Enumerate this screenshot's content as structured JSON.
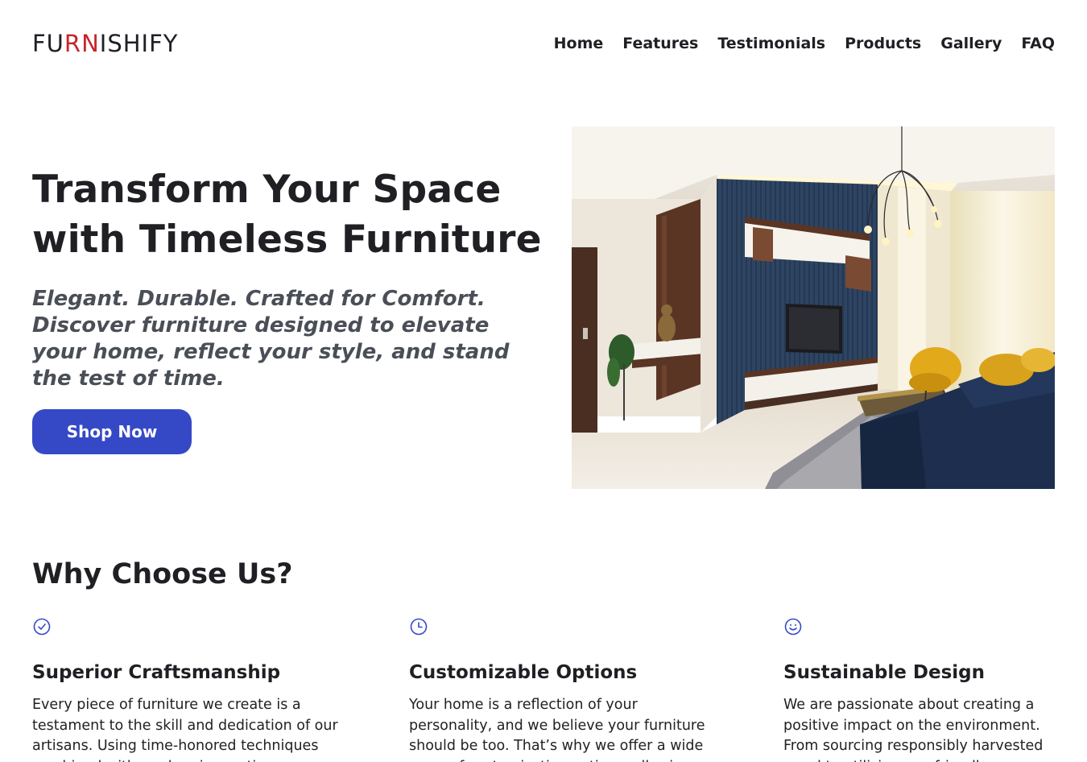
{
  "header": {
    "logo": {
      "part1": "FU",
      "accent": "RN",
      "part2": "ISHIFY"
    },
    "nav": [
      "Home",
      "Features",
      "Testimonials",
      "Products",
      "Gallery",
      "FAQ"
    ]
  },
  "hero": {
    "title_line1": "Transform Your Space",
    "title_line2": "with Timeless Furniture",
    "subtitle": "Elegant. Durable. Crafted for Comfort. Discover furniture designed to elevate your home, reflect your style, and stand the test of time.",
    "cta_label": "Shop Now"
  },
  "why": {
    "title": "Why Choose Us?",
    "features": [
      {
        "icon": "check-circle-icon",
        "title": "Superior Craftsmanship",
        "text": "Every piece of furniture we create is a testament to the skill and dedication of our artisans. Using time-honored techniques combined with modern innovations, we"
      },
      {
        "icon": "clock-icon",
        "title": "Customizable Options",
        "text": "Your home is a reflection of your personality, and we believe your furniture should be too. That’s why we offer a wide array of customization options, allowing you"
      },
      {
        "icon": "smiley-icon",
        "title": "Sustainable Design",
        "text": "We are passionate about creating a positive impact on the environment. From sourcing responsibly harvested wood to utilizing eco-friendly"
      }
    ]
  },
  "colors": {
    "brand_accent": "#c6252b",
    "button": "#3549c7",
    "text_dark": "#1f1f24",
    "subtitle": "#4a4e57",
    "icon": "#3549c7"
  }
}
